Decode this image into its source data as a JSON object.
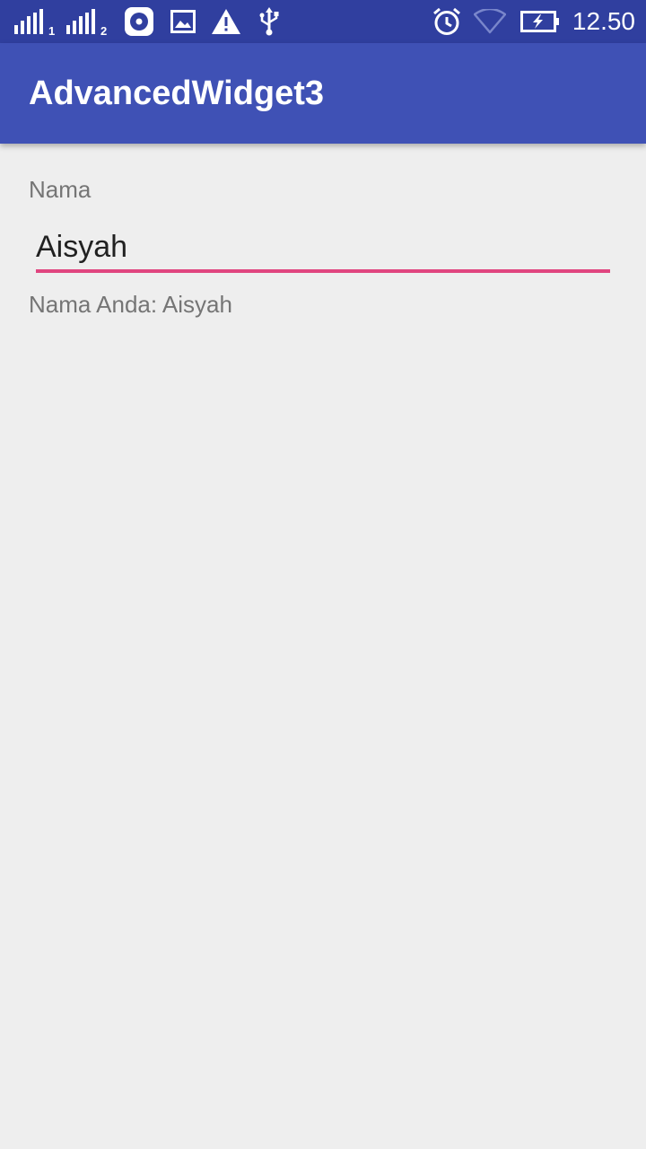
{
  "status_bar": {
    "sim1_label": "1",
    "sim2_label": "2",
    "time": "12.50",
    "icons": [
      "signal-icon",
      "signal-icon",
      "music-player-icon",
      "image-icon",
      "warning-icon",
      "usb-icon",
      "alarm-icon",
      "wifi-icon",
      "battery-charging-icon"
    ]
  },
  "app_bar": {
    "title": "AdvancedWidget3"
  },
  "form": {
    "label": "Nama",
    "input_value": "Aisyah",
    "result": "Nama Anda: Aisyah"
  },
  "colors": {
    "status_bar": "#303f9f",
    "app_bar": "#3f51b5",
    "accent": "#e0457f",
    "background": "#eeeeee"
  }
}
